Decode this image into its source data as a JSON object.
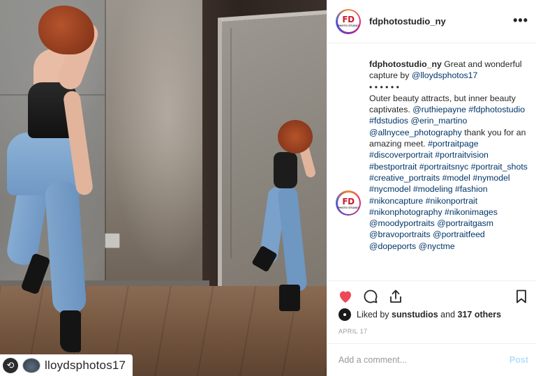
{
  "post": {
    "account_name": "fdphotostudio_ny",
    "logo_text": "FD",
    "logo_subtext": "PHOTO STUDIO",
    "more_icon": "more-horizontal-icon",
    "photo_credit": "lloydsphotos17"
  },
  "caption": {
    "author": "fdphotostudio_ny",
    "line1": " Great and wonderful capture by ",
    "mention1": "@lloydsphotos17",
    "dots": "• • • • • •",
    "text2": "Outer beauty attracts, but inner beauty captivates. ",
    "mention2": "@ruthiepayne",
    "tags1": "#fdphotostudio #fdstudios",
    "mention3": "@erin_martino",
    "mention4": "@allnycee_photography",
    "text3": " thank you for an amazing meet. ",
    "tags2": "#portraitpage #discoverportrait #portraitvision #bestportrait #portraitsnyc #portrait_shots #creative_portraits #model #nymodel #nycmodel #modeling #fashion #nikoncapture #nikonportrait #nikonphotography #nikonimages @moodyportraits @portraitgasm @bravoportraits @portraitfeed @dopeports @nyctme"
  },
  "actions": {
    "like_icon": "heart-icon",
    "comment_icon": "comment-icon",
    "share_icon": "share-icon",
    "save_icon": "bookmark-icon",
    "like_color": "#ed4956"
  },
  "likes": {
    "prefix": "Liked by ",
    "user": "sunstudios",
    "middle": " and ",
    "others": "317 others"
  },
  "date": "APRIL 17",
  "comment_box": {
    "placeholder": "Add a comment...",
    "post_label": "Post"
  }
}
